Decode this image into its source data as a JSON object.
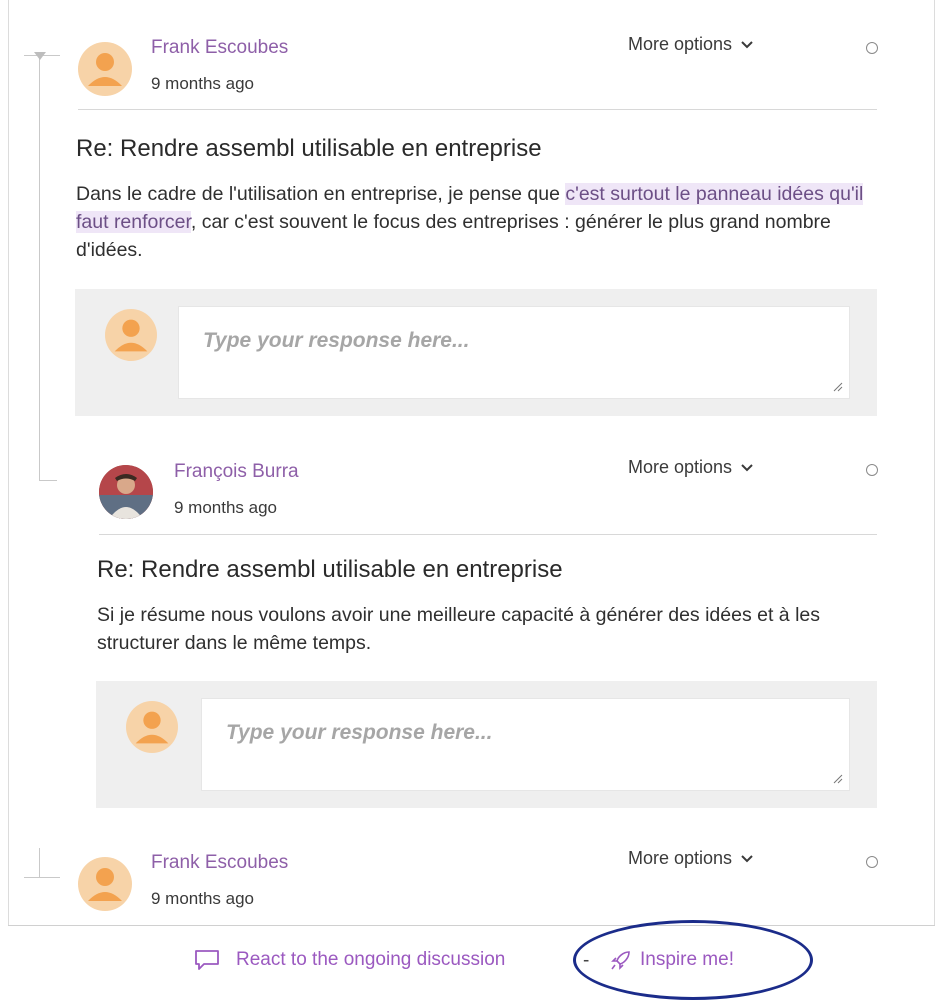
{
  "posts": [
    {
      "author": "Frank Escoubes",
      "time": "9 months ago",
      "more_options": "More options",
      "title": "Re: Rendre assembl utilisable en entreprise",
      "body_before": "Dans le cadre de l'utilisation en entreprise, je pense que ",
      "body_highlight": "c'est surtout le panneau idées qu'il faut renforcer",
      "body_after": ", car c'est souvent le focus des entreprises : générer le plus grand nombre d'idées.",
      "reply_placeholder": "Type your response here..."
    },
    {
      "author": "François Burra",
      "time": "9 months ago",
      "more_options": "More options",
      "title": "Re: Rendre assembl utilisable en entreprise",
      "body": "Si je résume nous voulons avoir une meilleure capacité à générer des idées et à les structurer dans le même temps.",
      "reply_placeholder": "Type your response here..."
    },
    {
      "author": "Frank Escoubes",
      "time": "9 months ago",
      "more_options": "More options"
    }
  ],
  "footer": {
    "react_label": "React to the ongoing discussion",
    "separator": "-",
    "inspire_label": "Inspire me!"
  },
  "colors": {
    "accent": "#9b59c0",
    "author": "#8e5fa8",
    "highlight_bg": "#efe6f7",
    "annotation": "#1b2c8a"
  },
  "icons": {
    "avatar_default": "person-silhouette-icon",
    "chevron": "chevron-down-icon",
    "react": "speech-bubble-icon",
    "inspire": "rocket-icon"
  }
}
